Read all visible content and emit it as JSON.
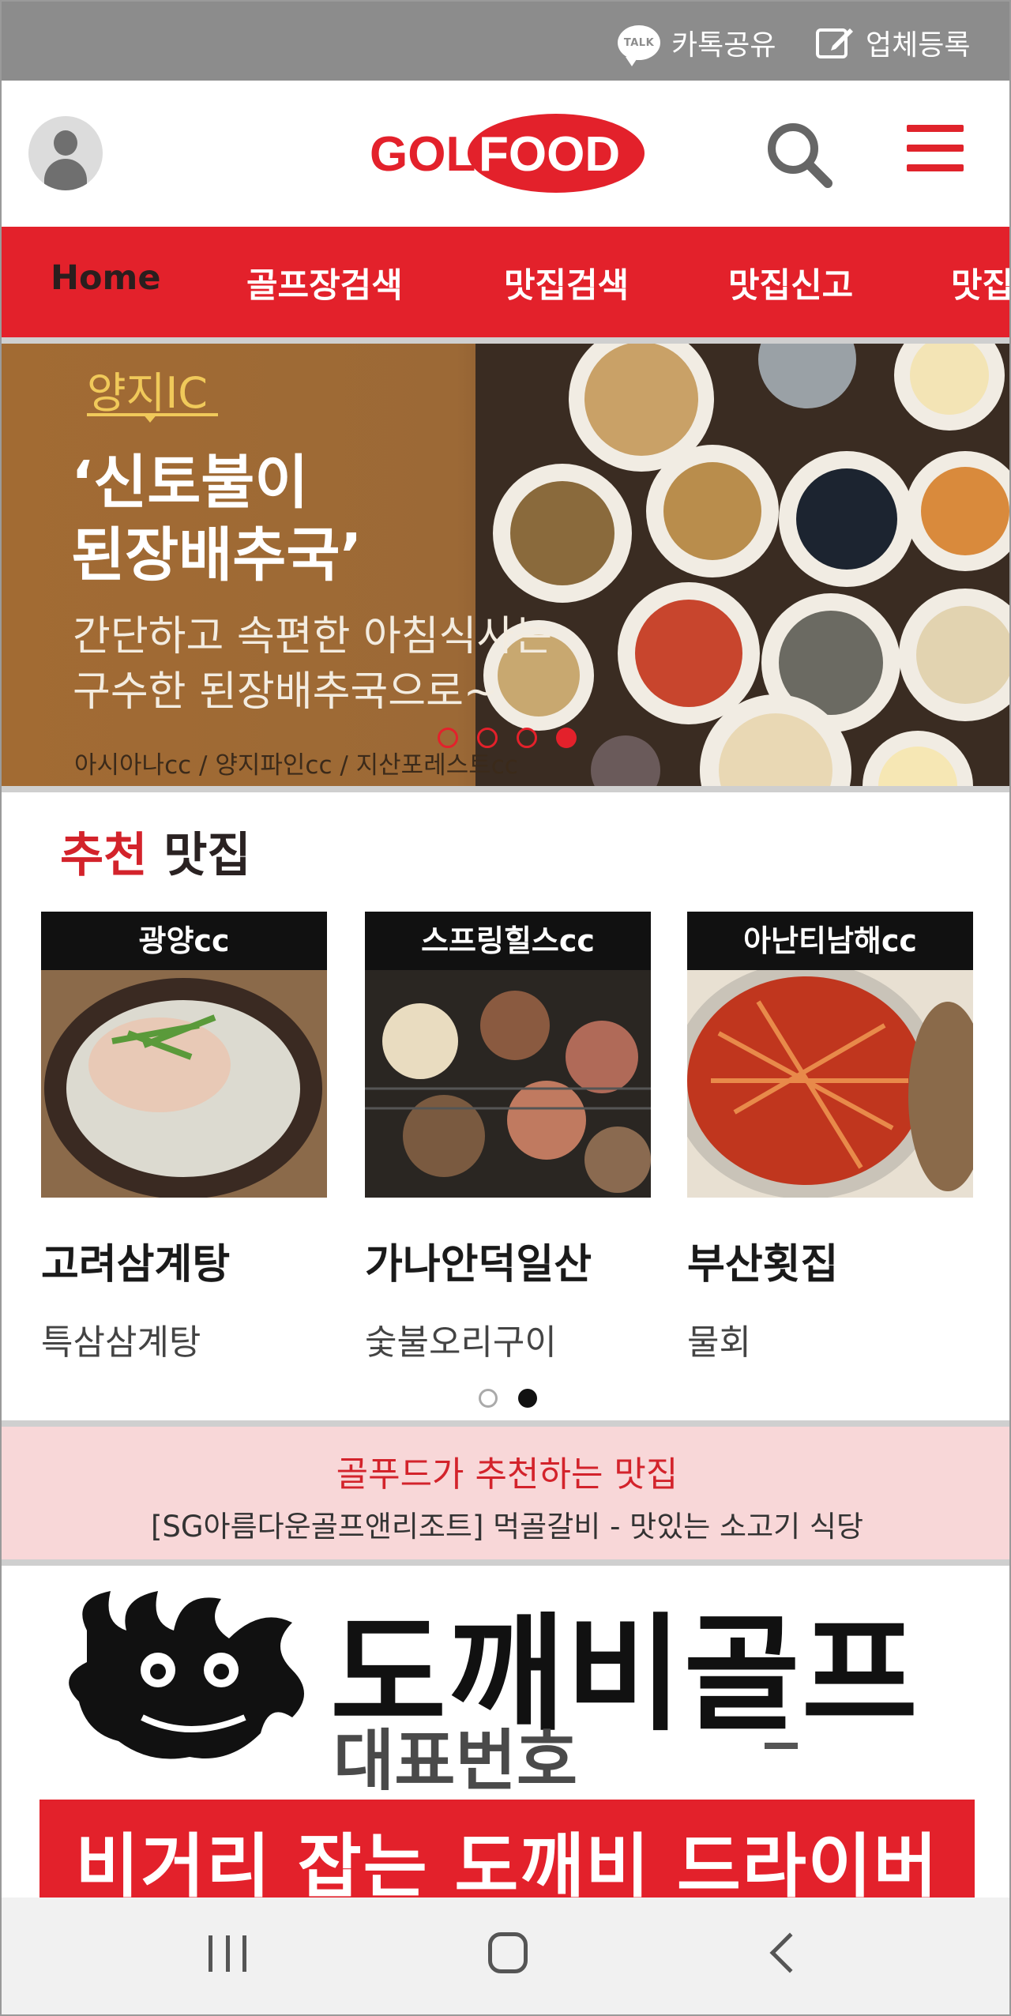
{
  "utility_bar": {
    "kakao_badge": "TALK",
    "kakao_share_label": "카톡공유",
    "register_label": "업체등록"
  },
  "header": {
    "logo_text": "GOLFOOD"
  },
  "nav": {
    "items": [
      "Home",
      "골프장검색",
      "맛집검색",
      "맛집신고",
      "맛집"
    ],
    "active_index": 0
  },
  "banner": {
    "location": "양지IC",
    "title": "‘신토불이\n된장배추국’",
    "description": "간단하고 속편한 아침식사는\n구수한 된장배추국으로~",
    "courses": "아시아나cc / 양지파인cc / 지산포레스트cc",
    "slide_count": 4,
    "active_slide": 4
  },
  "recommended": {
    "title_highlight": "추천",
    "title_rest": "맛집",
    "cards": [
      {
        "tag": "광양cc",
        "name": "고려삼계탕",
        "menu": "특삼삼계탕"
      },
      {
        "tag": "스프링힐스cc",
        "name": "가나안덕일산",
        "menu": "숯불오리구이"
      },
      {
        "tag": "아난티남해cc",
        "name": "부산횟집",
        "menu": "물회"
      }
    ],
    "page_count": 2,
    "active_page": 2
  },
  "notice": {
    "title": "골푸드가 추천하는 맛집",
    "text": "[SG아름다운골프앤리조트] 먹골갈비 - 맛있는 소고기 식당"
  },
  "ad": {
    "name": "도깨비골프",
    "phone_label": "대표번호",
    "slogan": "비거리 잡는 도깨비 드라이버"
  },
  "colors": {
    "brand_red": "#e3212b",
    "utility_gray": "#8c8c8c",
    "notice_pink": "#f8d7d8",
    "banner_gold": "#f0c95a"
  },
  "icons": {
    "profile": "user-avatar-icon",
    "search": "search-icon",
    "menu": "hamburger-menu-icon",
    "share": "kakao-talk-icon",
    "register": "edit-icon"
  }
}
